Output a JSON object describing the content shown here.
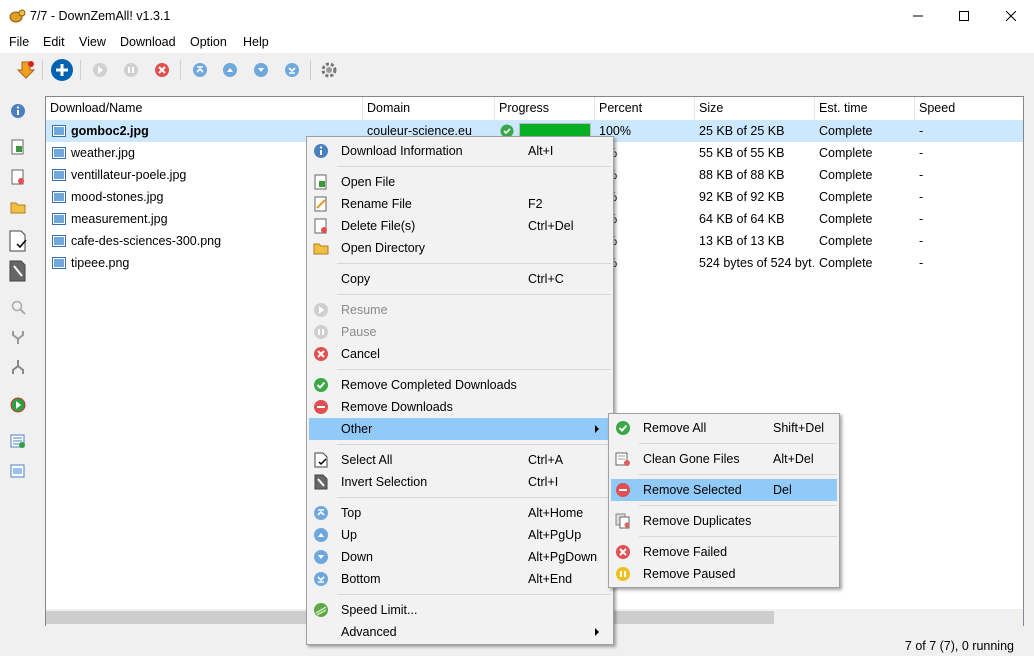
{
  "window": {
    "title": "7/7 - DownZemAll! v1.3.1",
    "minimize_icon": "minimize-icon",
    "maximize_icon": "maximize-icon",
    "close_icon": "close-icon"
  },
  "menubar": {
    "items": [
      "File",
      "Edit",
      "View",
      "Download",
      "Option",
      "Help"
    ]
  },
  "toolbar": {
    "icons": [
      "download-arrow-icon",
      "add-icon",
      "resume-icon",
      "pause-icon",
      "cancel-icon",
      "top-icon",
      "up-icon",
      "down-icon",
      "bottom-icon",
      "settings-icon"
    ]
  },
  "sidebar": {
    "icons": [
      "info-icon",
      "open-file-icon",
      "delete-file-icon",
      "open-folder-icon",
      "select-all-icon",
      "invert-selection-icon",
      "magnify-icon",
      "merge-icon",
      "split-icon",
      "resume-green-icon",
      "add-batch-icon",
      "add-list-icon"
    ]
  },
  "table": {
    "headers": [
      "Download/Name",
      "Domain",
      "Progress",
      "Percent",
      "Size",
      "Est. time",
      "Speed"
    ],
    "rows": [
      {
        "name": "gomboc2.jpg",
        "domain": "couleur-science.eu",
        "progress": 1.0,
        "percent": "100%",
        "size": "25 KB of 25 KB",
        "est": "Complete",
        "speed": "-"
      },
      {
        "name": "weather.jpg",
        "domain": "",
        "progress": 1.0,
        "percent": "0%",
        "size": "55 KB of 55 KB",
        "est": "Complete",
        "speed": "-"
      },
      {
        "name": "ventillateur-poele.jpg",
        "domain": "",
        "progress": 1.0,
        "percent": "0%",
        "size": "88 KB of 88 KB",
        "est": "Complete",
        "speed": "-"
      },
      {
        "name": "mood-stones.jpg",
        "domain": "",
        "progress": 1.0,
        "percent": "0%",
        "size": "92 KB of 92 KB",
        "est": "Complete",
        "speed": "-"
      },
      {
        "name": "measurement.jpg",
        "domain": "",
        "progress": 1.0,
        "percent": "0%",
        "size": "64 KB of 64 KB",
        "est": "Complete",
        "speed": "-"
      },
      {
        "name": "cafe-des-sciences-300.png",
        "domain": "",
        "progress": 1.0,
        "percent": "0%",
        "size": "13 KB of 13 KB",
        "est": "Complete",
        "speed": "-"
      },
      {
        "name": "tipeee.png",
        "domain": "",
        "progress": 1.0,
        "percent": "0%",
        "size": "524 bytes of 524 byt…",
        "est": "Complete",
        "speed": "-"
      }
    ]
  },
  "status": {
    "text": "7 of 7 (7), 0 running"
  },
  "context_menu": {
    "items": [
      {
        "label": "Download Information",
        "shortcut": "Alt+I",
        "icon": "info-icon"
      },
      {
        "label": "Open File",
        "shortcut": "",
        "icon": "open-file-icon"
      },
      {
        "label": "Rename File",
        "shortcut": "F2",
        "icon": "rename-icon"
      },
      {
        "label": "Delete File(s)",
        "shortcut": "Ctrl+Del",
        "icon": "delete-file-icon"
      },
      {
        "label": "Open Directory",
        "shortcut": "",
        "icon": "folder-icon"
      },
      {
        "label": "Copy",
        "shortcut": "Ctrl+C",
        "icon": ""
      },
      {
        "label": "Resume",
        "shortcut": "",
        "icon": "resume-icon"
      },
      {
        "label": "Pause",
        "shortcut": "",
        "icon": "pause-icon"
      },
      {
        "label": "Cancel",
        "shortcut": "",
        "icon": "cancel-icon"
      },
      {
        "label": "Remove Completed Downloads",
        "shortcut": "",
        "icon": "check-icon"
      },
      {
        "label": "Remove Downloads",
        "shortcut": "",
        "icon": "remove-icon"
      },
      {
        "label": "Other",
        "shortcut": "",
        "icon": ""
      },
      {
        "label": "Select All",
        "shortcut": "Ctrl+A",
        "icon": "select-all-icon"
      },
      {
        "label": "Invert Selection",
        "shortcut": "Ctrl+I",
        "icon": "invert-selection-icon"
      },
      {
        "label": "Top",
        "shortcut": "Alt+Home",
        "icon": "top-icon"
      },
      {
        "label": "Up",
        "shortcut": "Alt+PgUp",
        "icon": "up-icon"
      },
      {
        "label": "Down",
        "shortcut": "Alt+PgDown",
        "icon": "down-icon"
      },
      {
        "label": "Bottom",
        "shortcut": "Alt+End",
        "icon": "bottom-icon"
      },
      {
        "label": "Speed Limit...",
        "shortcut": "",
        "icon": "speed-limit-icon"
      },
      {
        "label": "Advanced",
        "shortcut": "",
        "icon": ""
      }
    ]
  },
  "submenu": {
    "items": [
      {
        "label": "Remove All",
        "shortcut": "Shift+Del",
        "icon": "check-icon"
      },
      {
        "label": "Clean Gone Files",
        "shortcut": "Alt+Del",
        "icon": "clean-icon"
      },
      {
        "label": "Remove Selected",
        "shortcut": "Del",
        "icon": "remove-icon"
      },
      {
        "label": "Remove Duplicates",
        "shortcut": "",
        "icon": "duplicates-icon"
      },
      {
        "label": "Remove Failed",
        "shortcut": "",
        "icon": "cancel-icon"
      },
      {
        "label": "Remove Paused",
        "shortcut": "",
        "icon": "pause-yellow-icon"
      }
    ]
  },
  "colors": {
    "selection": "#cce8ff",
    "menu_highlight": "#91c9f7",
    "progress": "#06b025",
    "accent_blue": "#0063b1"
  }
}
